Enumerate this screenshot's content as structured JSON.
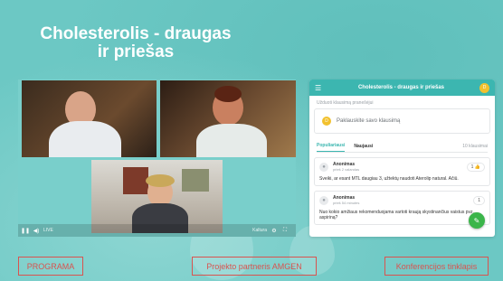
{
  "page": {
    "title": "Cholesterolis - draugas ir priešas"
  },
  "video": {
    "controls": {
      "live_label": "LIVE",
      "brand": "Kaltura"
    }
  },
  "qa_panel": {
    "header_title": "Cholesterolis - draugas ir priešas",
    "user_initial": "D",
    "subtitle": "Užduoti klausimą pranešėjui",
    "ask_placeholder": "Paklauskite savo klausimą",
    "tabs": [
      {
        "label": "Populiariausi"
      },
      {
        "label": "Naujausi"
      }
    ],
    "count_label": "10 klausimai",
    "questions": [
      {
        "author": "Anonimas",
        "time": "prieš 2 valandas",
        "likes": "1",
        "text": "Sveiki, ar esant MTL daugiau 3, užtektų naudoti Aterolip natural. Ačiū."
      },
      {
        "author": "Anonimas",
        "time": "prieš 54 minutes",
        "likes": "1",
        "text": "Nuo kokio amžiaus rekomenduojama vartoti kraują skystinančius vaistus pvz., aspiriną?"
      }
    ]
  },
  "footer": {
    "program": "PROGRAMA",
    "partner": "Projekto partneris AMGEN",
    "website": "Konferencijos tinklapis"
  }
}
